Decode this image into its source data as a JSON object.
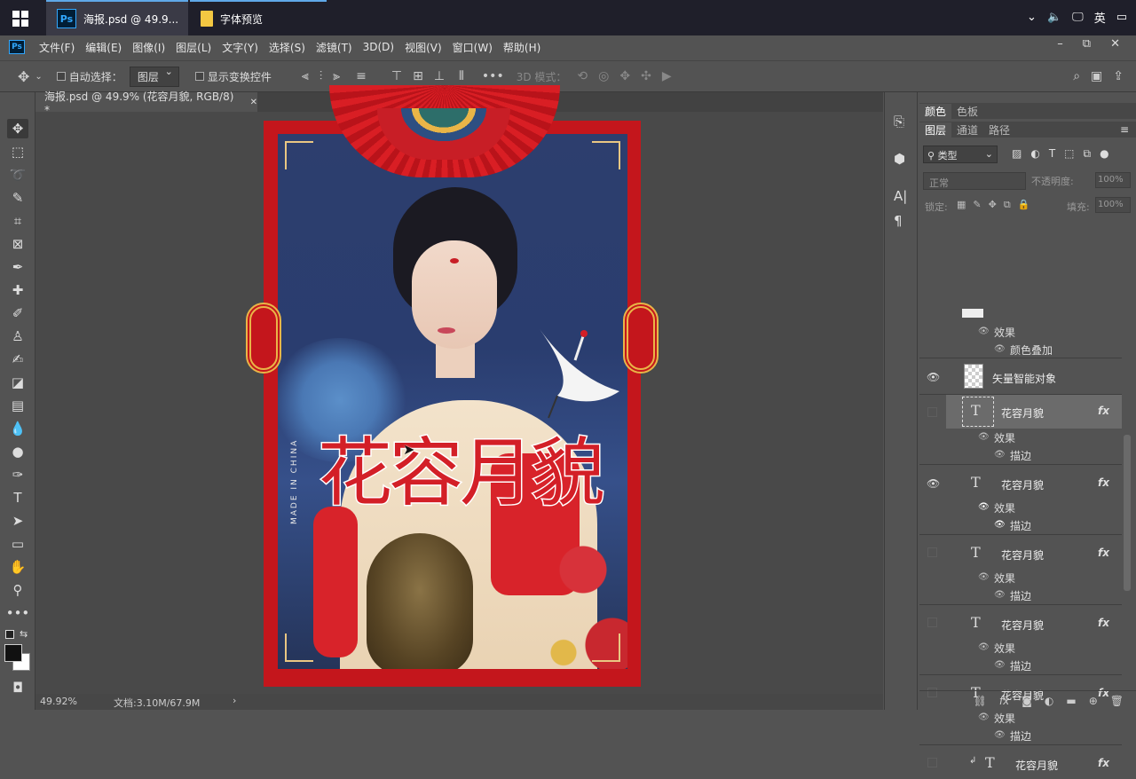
{
  "taskbar": {
    "tab1_title": "海报.psd @ 49.9...",
    "tab2_title": "字体预览",
    "ime": "英",
    "ps_badge": "Ps"
  },
  "menubar": {
    "items": [
      "文件(F)",
      "编辑(E)",
      "图像(I)",
      "图层(L)",
      "文字(Y)",
      "选择(S)",
      "滤镜(T)",
      "3D(D)",
      "视图(V)",
      "窗口(W)",
      "帮助(H)"
    ],
    "ps_badge": "Ps"
  },
  "options": {
    "auto_select": "自动选择：",
    "auto_select_target": "图层",
    "show_transform": "显示变换控件",
    "mode_3d": "3D 模式："
  },
  "document": {
    "tab_title": "海报.psd @ 49.9% (花容月貌, RGB/8) *"
  },
  "poster": {
    "title": "花容月貌",
    "side_text": "MADE IN CHINA"
  },
  "status": {
    "zoom": "49.92%",
    "doc_size": "文档:3.10M/67.9M"
  },
  "panels": {
    "top_tabs": [
      "颜色",
      "色板"
    ],
    "layer_tabs": [
      "图层",
      "通道",
      "路径"
    ],
    "filter_kind": "类型",
    "blend_mode": "正常",
    "opacity_label": "不透明度:",
    "opacity_value": "100%",
    "lock_label": "锁定:",
    "fill_label": "填充:",
    "fill_value": "100%"
  },
  "layers": {
    "partial_effects": "效果",
    "partial_effect_color": "颜色叠加",
    "smart_object": "矢量智能对象",
    "text_layers": [
      {
        "name": "花容月貌",
        "effects": "效果",
        "stroke": "描边",
        "visible": false,
        "selected": true
      },
      {
        "name": "花容月貌",
        "effects": "效果",
        "stroke": "描边",
        "visible": true,
        "selected": false
      },
      {
        "name": "花容月貌",
        "effects": "效果",
        "stroke": "描边",
        "visible": false,
        "selected": false
      },
      {
        "name": "花容月貌",
        "effects": "效果",
        "stroke": "描边",
        "visible": false,
        "selected": false
      },
      {
        "name": "花容月貌",
        "effects": "效果",
        "stroke": "描边",
        "visible": false,
        "selected": false
      },
      {
        "name": "花容月貌",
        "visible": false,
        "selected": false
      }
    ],
    "fx_label": "fx"
  },
  "colors": {
    "poster_red": "#c4161c",
    "accent_blue": "#31a8ff"
  }
}
